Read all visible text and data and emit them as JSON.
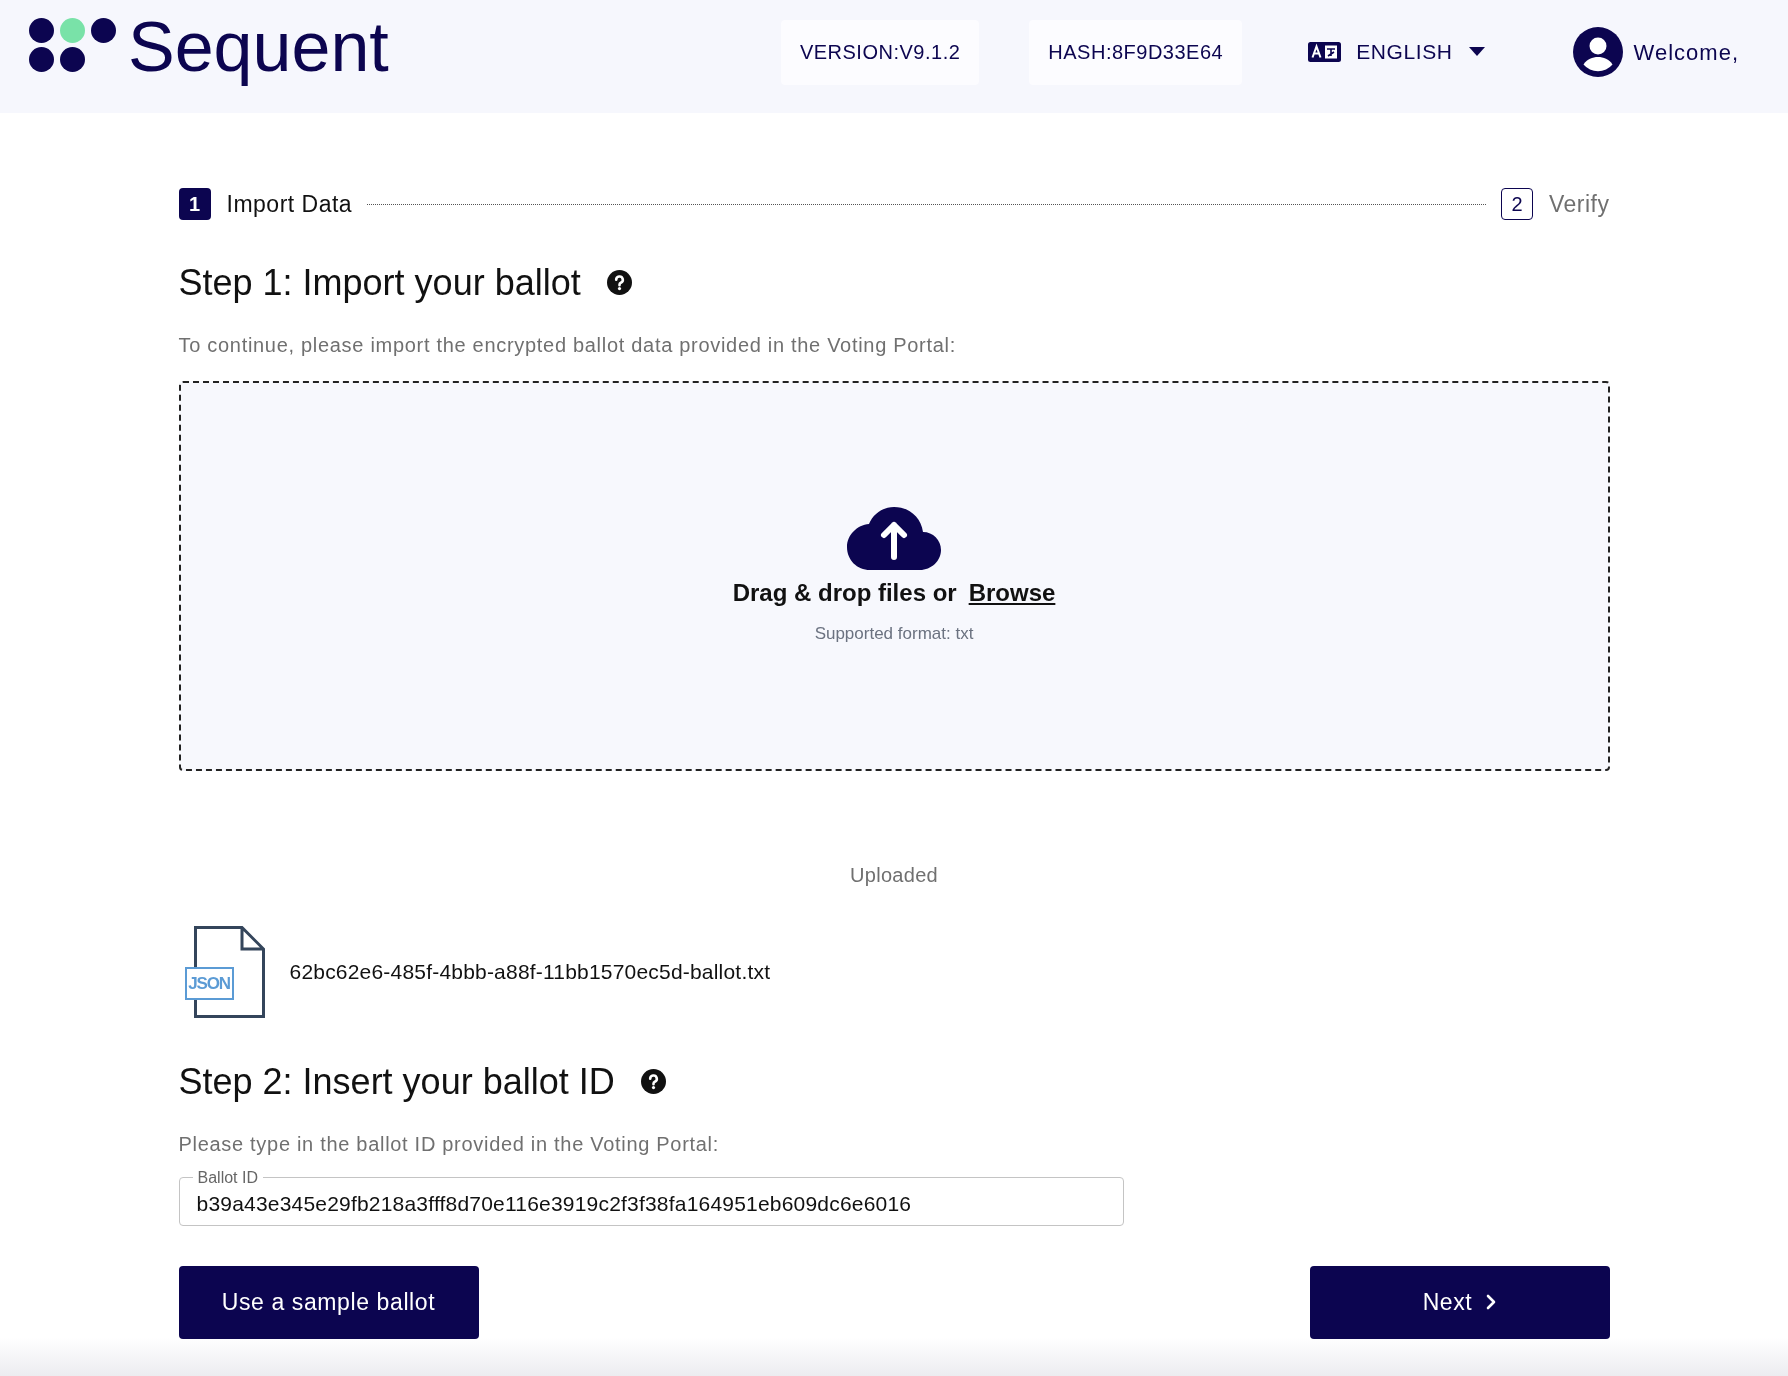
{
  "header": {
    "logo_text": "Sequent",
    "version": "VERSION:V9.1.2",
    "hash": "HASH:8F9D33E64",
    "language": "ENGLISH",
    "welcome": "Welcome,"
  },
  "stepper": [
    {
      "number": "1",
      "label": "Import Data",
      "selected": true
    },
    {
      "number": "2",
      "label": "Verify",
      "selected": false
    }
  ],
  "step_1": {
    "title": "Step 1: Import your ballot",
    "description": "To continue, please import the encrypted ballot data provided in the Voting Portal:",
    "dropzone": {
      "prompt": "Drag & drop files or",
      "browse_link": "Browse",
      "hint": "Supported format: txt"
    },
    "uploaded_heading": "Uploaded",
    "files": [
      {
        "name": "62bc62e6-485f-4bbb-a88f-11bb1570ec5d-ballot.txt",
        "type_tag": "JSON"
      }
    ]
  },
  "step_2": {
    "title": "Step 2: Insert your ballot ID",
    "description": "Please type in the ballot ID provided in the Voting Portal:",
    "ballot_id_field": {
      "label": "Ballot ID",
      "value": "b39a43e345e29fb218a3fff8d70e116e3919c2f3f38fa164951eb609dc6e6016"
    }
  },
  "actions": {
    "sample_ballot": "Use a sample ballot",
    "next": "Next"
  }
}
